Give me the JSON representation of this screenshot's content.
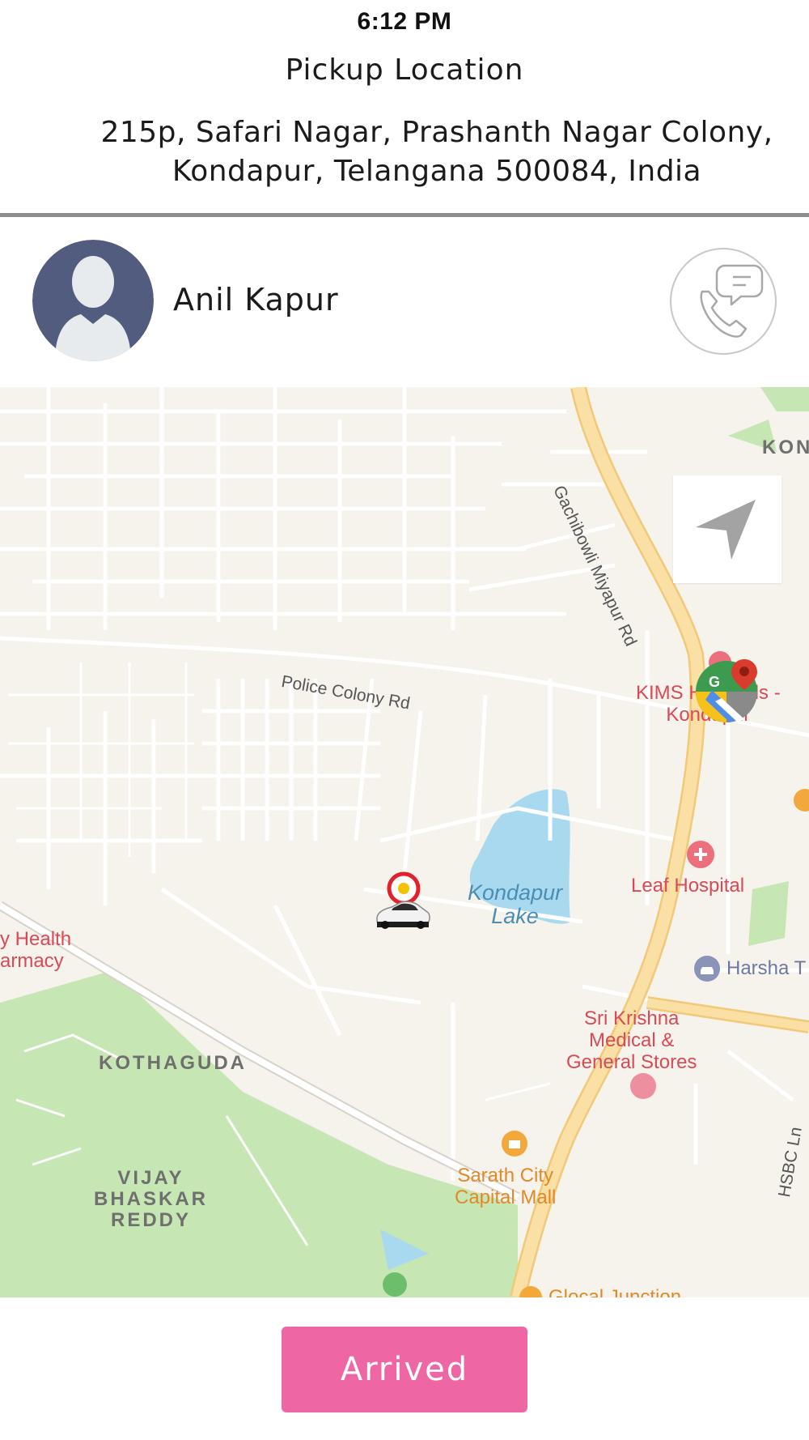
{
  "status_bar": {
    "time": "6:12 PM"
  },
  "header": {
    "title": "Pickup Location",
    "address": "215p, Safari Nagar, Prashanth Nagar Colony, Kondapur, Telangana 500084, India"
  },
  "rider": {
    "name": "Anil Kapur",
    "avatar_icon": "person-silhouette-icon",
    "contact_icon": "phone-chat-icon"
  },
  "map": {
    "labels": {
      "road_gachibowli": "Gachibowli Miyapur Rd",
      "road_police_colony": "Police Colony Rd",
      "road_hsbc": "HSBC Ln",
      "area_kon": "KON",
      "area_kothaguda": "KOTHAGUDA",
      "area_vijay": "VIJAY\nBHASKAR\nREDDY",
      "lake": "Kondapur\nLake",
      "kims": "KIMS Hospitals -\nKondapur",
      "leaf_hospital": "Leaf Hospital",
      "harsha": "Harsha T",
      "health_pharmacy": "y Health\narmacy",
      "sri_krishna": "Sri Krishna\nMedical &\nGeneral Stores",
      "sarath_city": "Sarath City\nCapital Mall",
      "glocal": "Glocal Junction"
    },
    "icons": {
      "recenter": "navigation-arrow-icon",
      "google_maps": "google-maps-icon",
      "pickup_marker": "pickup-pin-icon",
      "car": "car-icon"
    },
    "colors": {
      "land": "#f6f2ec",
      "street": "#ffffff",
      "highway": "#fbe0a6",
      "park": "#c6e6b4",
      "water": "#a9d9ef"
    }
  },
  "actions": {
    "arrived_label": "Arrived"
  },
  "theme": {
    "accent": "#ef66a4",
    "divider": "#8c8c8c"
  }
}
